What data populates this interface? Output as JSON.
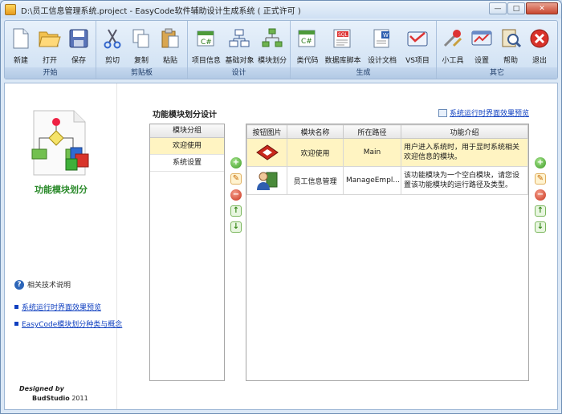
{
  "window": {
    "title": "D:\\员工信息管理系统.project - EasyCode软件辅助设计生成系统 ( 正式许可 )",
    "buttons": {
      "minimize": "—",
      "maximize": "□",
      "close": "✕"
    }
  },
  "ribbon": {
    "groups": [
      {
        "label": "开始",
        "tools": [
          {
            "label": "新建",
            "icon": "new-document-icon"
          },
          {
            "label": "打开",
            "icon": "open-folder-icon"
          },
          {
            "label": "保存",
            "icon": "save-disk-icon"
          }
        ]
      },
      {
        "label": "剪贴板",
        "tools": [
          {
            "label": "剪切",
            "icon": "cut-scissors-icon"
          },
          {
            "label": "复制",
            "icon": "copy-icon"
          },
          {
            "label": "粘贴",
            "icon": "paste-clipboard-icon"
          }
        ]
      },
      {
        "label": "设计",
        "tools": [
          {
            "label": "项目信息",
            "icon": "project-info-icon"
          },
          {
            "label": "基础对象",
            "icon": "base-object-icon"
          },
          {
            "label": "模块划分",
            "icon": "module-division-icon"
          }
        ]
      },
      {
        "label": "生成",
        "tools": [
          {
            "label": "类代码",
            "icon": "class-code-icon"
          },
          {
            "label": "数据库脚本",
            "icon": "sql-script-icon"
          },
          {
            "label": "设计文档",
            "icon": "design-doc-icon"
          },
          {
            "label": "VS项目",
            "icon": "vs-project-icon"
          }
        ]
      },
      {
        "label": "其它",
        "tools": [
          {
            "label": "小工具",
            "icon": "tools-icon"
          },
          {
            "label": "设置",
            "icon": "settings-icon"
          },
          {
            "label": "帮助",
            "icon": "help-icon"
          },
          {
            "label": "退出",
            "icon": "exit-icon"
          }
        ]
      }
    ]
  },
  "left": {
    "feature_title": "功能模块划分",
    "help_title": "相关技术说明",
    "links": [
      "系统运行时界面效果预览",
      "EasyCode模块划分种类与概念"
    ],
    "designed_by": "Designed by",
    "studio": "BudStudio",
    "year": "2011"
  },
  "main": {
    "section_title": "功能模块划分设计",
    "preview_link": "系统运行时界面效果预览",
    "group_list": {
      "header": "模块分组",
      "items": [
        "欢迎使用",
        "系统设置"
      ],
      "selected": "欢迎使用"
    },
    "grid": {
      "columns": [
        "按钮图片",
        "模块名称",
        "所在路径",
        "功能介绍"
      ],
      "rows": [
        {
          "icon": "welcome-module-icon",
          "name": "欢迎使用",
          "path": "Main",
          "desc": "用户进入系统时，用于显时系统相关欢迎信息的模块。",
          "selected": true
        },
        {
          "icon": "employee-module-icon",
          "name": "员工信息管理",
          "path": "ManageEmpl...",
          "desc": "该功能模块为一个空白模块，请您设置该功能模块的运行路径及类型。",
          "selected": false
        }
      ]
    }
  }
}
